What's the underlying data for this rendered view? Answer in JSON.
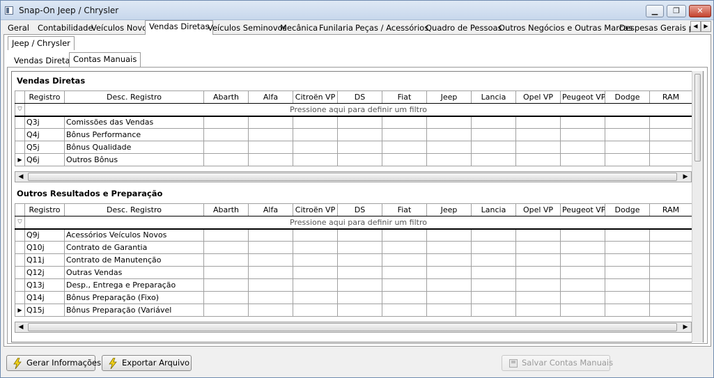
{
  "window": {
    "title": "Snap-On Jeep / Chrysler"
  },
  "main_tabs": [
    "Geral",
    "Contabilidade",
    "Veículos Novos",
    "Vendas Diretas",
    "Veículos Seminovos",
    "Mecânica",
    "Funilaria",
    "Peças / Acessórios",
    "Quadro de Pessoas",
    "Outros Negócios e Outras Marcas",
    "Despesas Gerais por I"
  ],
  "active_main_tab": "Vendas Diretas",
  "brand_tab": "Jeep / Chrysler",
  "sub_tabs": [
    "Vendas Diretas",
    "Contas Manuais"
  ],
  "active_sub_tab": "Contas Manuais",
  "columns": [
    "Registro",
    "Desc. Registro",
    "Abarth",
    "Alfa",
    "Citroën VP",
    "DS",
    "Fiat",
    "Jeep",
    "Lancia",
    "Opel VP",
    "Peugeot VP",
    "Dodge",
    "RAM"
  ],
  "filter_placeholder": "Pressione aqui para definir um filtro",
  "sections": [
    {
      "title": "Vendas Diretas",
      "rows": [
        {
          "registro": "Q3j",
          "desc": "Comissões das Vendas"
        },
        {
          "registro": "Q4j",
          "desc": "Bônus Performance"
        },
        {
          "registro": "Q5j",
          "desc": "Bônus Qualidade"
        },
        {
          "registro": "Q6j",
          "desc": "Outros Bônus"
        }
      ]
    },
    {
      "title": "Outros Resultados e Preparação",
      "rows": [
        {
          "registro": "Q9j",
          "desc": "Acessórios Veículos Novos"
        },
        {
          "registro": "Q10j",
          "desc": "Contrato de Garantia"
        },
        {
          "registro": "Q11j",
          "desc": "Contrato de Manutenção"
        },
        {
          "registro": "Q12j",
          "desc": "Outras Vendas"
        },
        {
          "registro": "Q13j",
          "desc": "Desp., Entrega e Preparação"
        },
        {
          "registro": "Q14j",
          "desc": "Bônus Preparação (Fixo)"
        },
        {
          "registro": "Q15j",
          "desc": "Bônus Preparação (Variável"
        }
      ]
    }
  ],
  "buttons": {
    "gerar": "Gerar Informações",
    "exportar": "Exportar Arquivo",
    "salvar": "Salvar Contas Manuais"
  },
  "icons": {
    "button": "lightning-bolt-icon",
    "save": "floppy-disk-icon"
  },
  "colors": {
    "window_frame": "#6f8bb0",
    "close_button": "#c4422e",
    "bolt": "#f2d21b"
  }
}
